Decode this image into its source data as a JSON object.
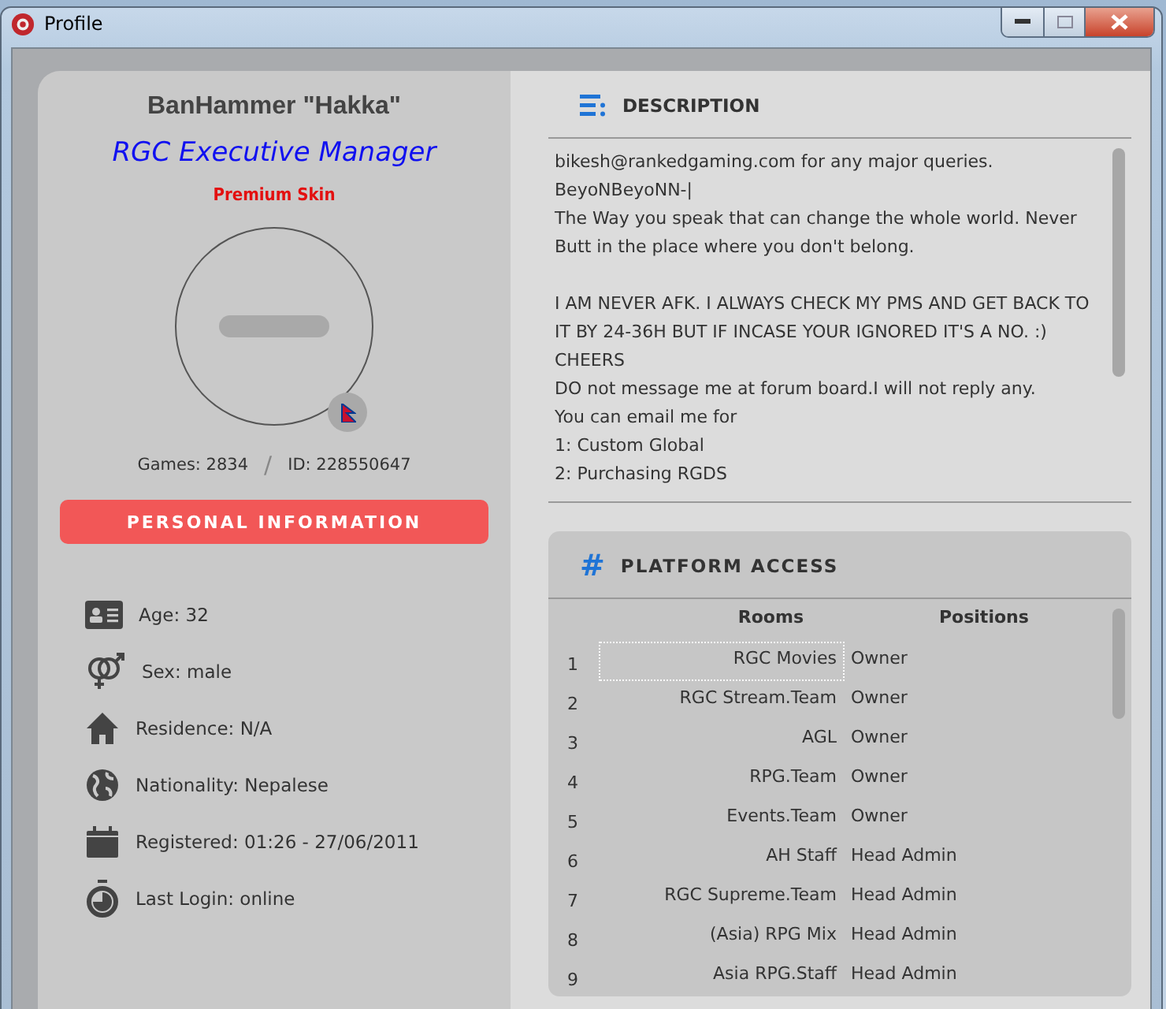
{
  "window": {
    "title": "Profile"
  },
  "profile": {
    "name": "BanHammer \"Hakka\"",
    "rank": "RGC Executive Manager",
    "skin": "Premium Skin",
    "games": "Games: 2834",
    "separator": "/",
    "id": "ID: 228550647"
  },
  "personal_info": {
    "button": "PERSONAL INFORMATION",
    "items": [
      {
        "kind": "id",
        "text": "Age: 32"
      },
      {
        "kind": "gender",
        "text": "Sex: male"
      },
      {
        "kind": "house",
        "text": "Residence: N/A"
      },
      {
        "kind": "globe",
        "text": "Nationality: Nepalese"
      },
      {
        "kind": "calendar",
        "text": "Registered: 01:26 - 27/06/2011"
      },
      {
        "kind": "stopwatch",
        "text": "Last Login: online"
      }
    ]
  },
  "description": {
    "heading": "DESCRIPTION",
    "paragraphs": [
      [
        "bikesh@rankedgaming.com for any major queries.",
        "BeyoNBeyoNN-|",
        "The Way you speak that can change the whole world. Never",
        "Butt in the place where you don't belong."
      ],
      [
        "I AM NEVER AFK. I ALWAYS CHECK MY PMS  AND GET BACK TO",
        "IT BY 24-36H BUT IF INCASE YOUR IGNORED IT'S A NO. :)",
        "CHEERS",
        "DO not message me at forum board.I will not reply any.",
        "You can email me for",
        "1: Custom Global",
        "2: Purchasing RGDS"
      ]
    ]
  },
  "platform_access": {
    "icon": "#",
    "heading": "PLATFORM ACCESS",
    "columns": [
      "Rooms",
      "Positions"
    ],
    "rows": [
      {
        "number": "1",
        "room": "RGC Movies",
        "position": "Owner",
        "selected": true
      },
      {
        "number": "2",
        "room": "RGC Stream.Team",
        "position": "Owner",
        "selected": false
      },
      {
        "number": "3",
        "room": "AGL",
        "position": "Owner",
        "selected": false
      },
      {
        "number": "4",
        "room": "RPG.Team",
        "position": "Owner",
        "selected": false
      },
      {
        "number": "5",
        "room": "Events.Team",
        "position": "Owner",
        "selected": false
      },
      {
        "number": "6",
        "room": "AH Staff",
        "position": "Head Admin",
        "selected": false
      },
      {
        "number": "7",
        "room": "RGC Supreme.Team",
        "position": "Head Admin",
        "selected": false
      },
      {
        "number": "8",
        "room": "(Asia) RPG Mix",
        "position": "Head Admin",
        "selected": false
      },
      {
        "number": "9",
        "room": "Asia RPG.Staff",
        "position": "Head Admin",
        "selected": false
      }
    ]
  }
}
